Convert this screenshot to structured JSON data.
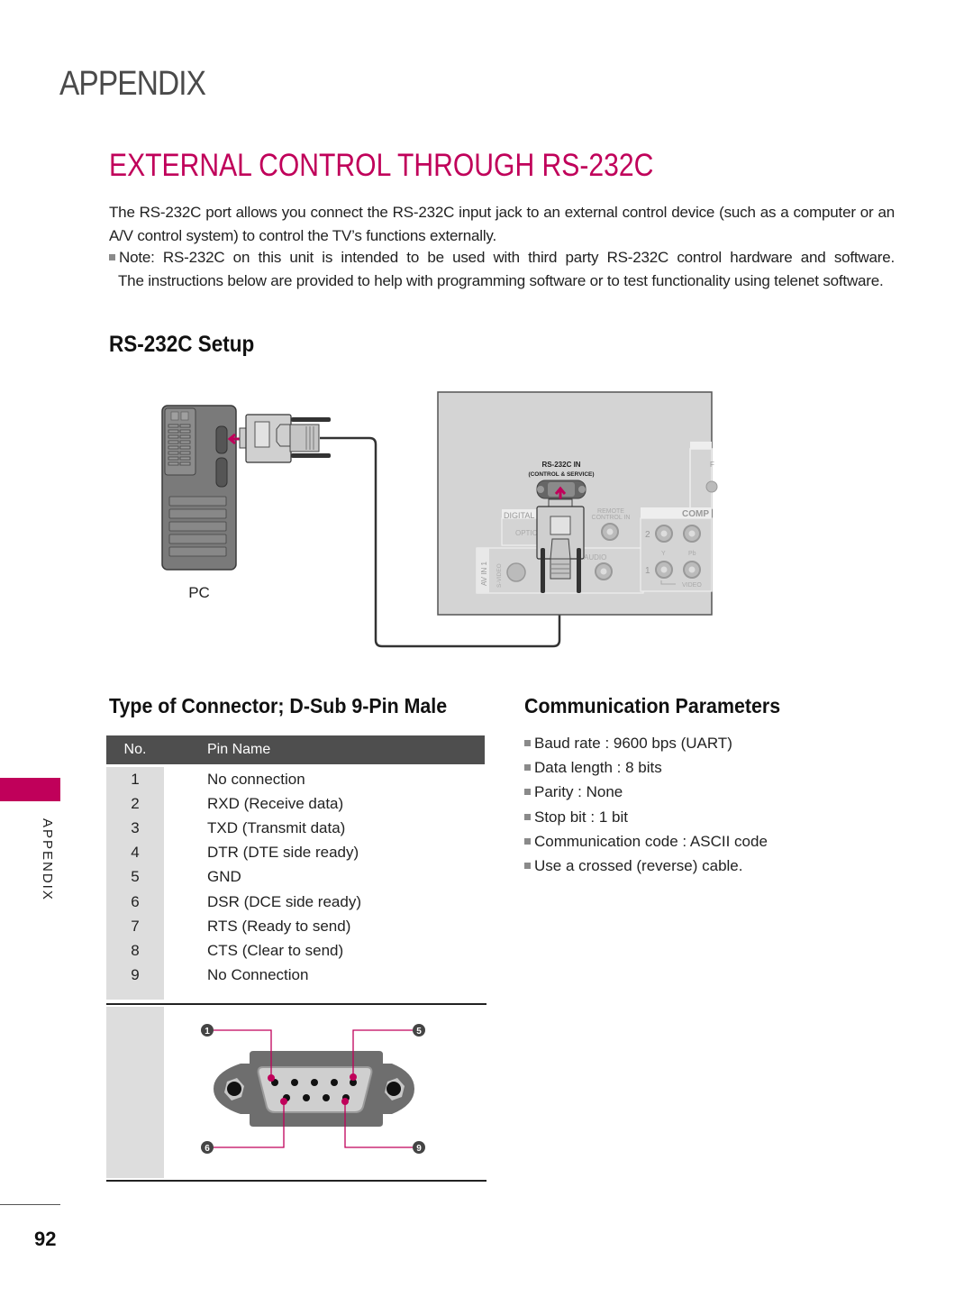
{
  "header": {
    "section": "APPENDIX",
    "title": "EXTERNAL CONTROL THROUGH RS-232C"
  },
  "intro": {
    "paragraph": "The RS-232C port allows you connect the RS-232C input jack to an external control device (such as a computer or an A/V control system) to control the TV’s functions externally.",
    "note_line1": "Note: RS-232C on this unit is intended to be used with third party RS-232C control hardware and software.",
    "note_line2": "The instructions below are provided to help with programming software or to test functionality using telenet software."
  },
  "setup": {
    "heading": "RS-232C Setup",
    "pc_label": "PC",
    "tv_port_label": "RS-232C IN",
    "tv_port_sublabel": "(CONTROL & SERVICE)",
    "tv_labels": {
      "digital": "DIGITAL",
      "optical": "OPTIC",
      "remote_line1": "REMOTE",
      "remote_line2": "CONTROL IN",
      "component": "COMP",
      "av_in": "AV IN 1",
      "s_video": "S-VIDEO",
      "audio": "AUDIO",
      "y": "Y",
      "pb": "Pb",
      "video": "VIDEO",
      "num1": "1",
      "num2": "2"
    },
    "accent_color": "#c0005a"
  },
  "connector": {
    "heading": "Type of Connector; D-Sub 9-Pin Male",
    "columns": [
      "No.",
      "Pin Name"
    ],
    "rows": [
      {
        "no": "1",
        "name": "No connection"
      },
      {
        "no": "2",
        "name": "RXD (Receive data)"
      },
      {
        "no": "3",
        "name": "TXD (Transmit data)"
      },
      {
        "no": "4",
        "name": "DTR (DTE side ready)"
      },
      {
        "no": "5",
        "name": "GND"
      },
      {
        "no": "6",
        "name": "DSR (DCE side ready)"
      },
      {
        "no": "7",
        "name": "RTS (Ready to send)"
      },
      {
        "no": "8",
        "name": "CTS (Clear to send)"
      },
      {
        "no": "9",
        "name": "No Connection"
      }
    ],
    "pin_callouts": [
      "1",
      "5",
      "6",
      "9"
    ]
  },
  "communication": {
    "heading": "Communication Parameters",
    "items": [
      "Baud rate : 9600 bps (UART)",
      "Data length : 8 bits",
      "Parity : None",
      "Stop bit : 1 bit",
      "Communication code : ASCII code",
      "Use a crossed (reverse) cable."
    ]
  },
  "sidebar": {
    "label": "APPENDIX",
    "tab_color": "#c0005a"
  },
  "footer": {
    "page_number": "92"
  }
}
